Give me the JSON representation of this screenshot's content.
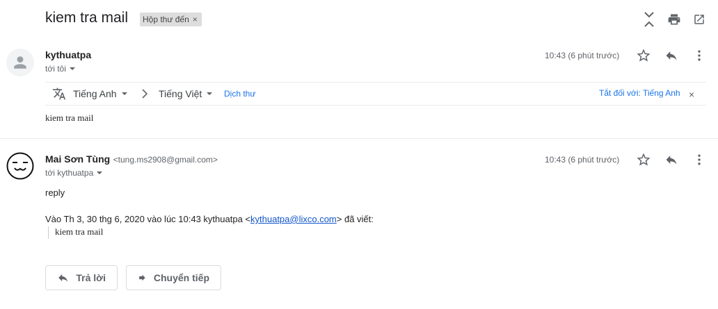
{
  "thread": {
    "subject": "kiem tra mail",
    "label": "Hộp thư đến",
    "label_remove": "×"
  },
  "message1": {
    "sender": "kythuatpa",
    "to": "tới tôi",
    "time": "10:43 (6 phút trước)",
    "body": "kiem tra mail",
    "translate": {
      "source_lang": "Tiếng Anh",
      "target_lang": "Tiếng Việt",
      "translate_link": "Dịch thư",
      "turn_off": "Tắt đối với: Tiếng Anh",
      "close": "×"
    }
  },
  "message2": {
    "sender": "Mai Sơn Tùng",
    "sender_email": "<tung.ms2908@gmail.com>",
    "to": "tới kythuatpa",
    "time": "10:43 (6 phút trước)",
    "body": "reply",
    "quote_header_prefix": "Vào Th 3, 30 thg 6, 2020 vào lúc 10:43 kythuatpa <",
    "quote_header_email": "kythuatpa@lixco.com",
    "quote_header_suffix": "> đã viết:",
    "quoted_body": "kiem tra mail"
  },
  "actions": {
    "reply": "Trả lời",
    "forward": "Chuyển tiếp"
  },
  "icons": {
    "expand": "unfold-icon",
    "print": "print-icon",
    "popout": "open-in-new-icon",
    "star": "star-icon",
    "reply": "reply-icon",
    "more": "more-vert-icon",
    "translate": "translate-icon"
  }
}
